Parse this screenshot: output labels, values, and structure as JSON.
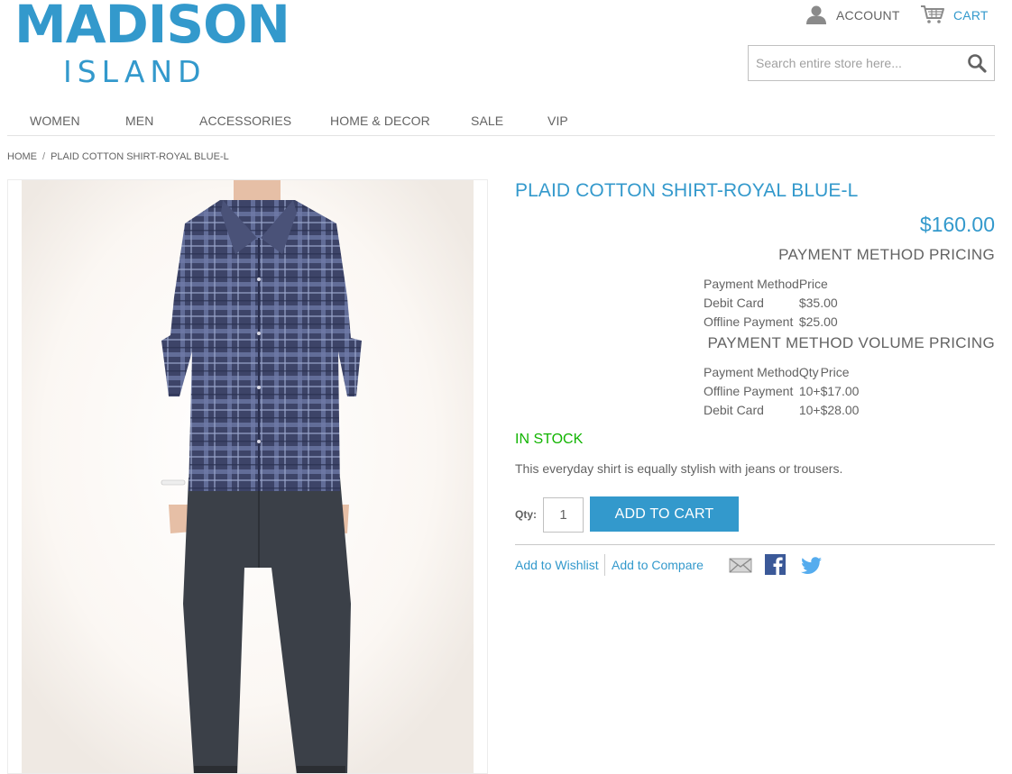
{
  "header": {
    "logo_main": "MADISON",
    "logo_sub": "ISLAND",
    "account_label": "ACCOUNT",
    "cart_label": "CART",
    "search_placeholder": "Search entire store here..."
  },
  "nav": {
    "items": [
      "WOMEN",
      "MEN",
      "ACCESSORIES",
      "HOME & DECOR",
      "SALE",
      "VIP"
    ]
  },
  "breadcrumb": {
    "home": "HOME",
    "separator": "/",
    "current": "PLAID COTTON SHIRT-ROYAL BLUE-L"
  },
  "product": {
    "name": "PLAID COTTON SHIRT-ROYAL BLUE-L",
    "price": "$160.00",
    "payment_pricing": {
      "title": "PAYMENT METHOD PRICING",
      "headers": [
        "Payment Method",
        "Price"
      ],
      "rows": [
        [
          "Debit Card",
          "$35.00"
        ],
        [
          "Offline Payment",
          "$25.00"
        ]
      ]
    },
    "volume_pricing": {
      "title": "PAYMENT METHOD VOLUME PRICING",
      "headers": [
        "Payment Method",
        "Qty",
        "Price"
      ],
      "rows": [
        [
          "Offline Payment",
          "10+",
          "$17.00"
        ],
        [
          "Debit Card",
          "10+",
          "$28.00"
        ]
      ]
    },
    "stock_status": "IN STOCK",
    "description": "This everyday shirt is equally stylish with jeans or trousers.",
    "qty_label": "Qty:",
    "qty_value": "1",
    "add_to_cart_label": "ADD TO CART",
    "wishlist_label": "Add to Wishlist",
    "compare_label": "Add to Compare"
  },
  "colors": {
    "brand": "#3399cc",
    "text": "#636363",
    "in_stock": "#11b400",
    "facebook": "#3b5998",
    "twitter": "#55acee"
  }
}
